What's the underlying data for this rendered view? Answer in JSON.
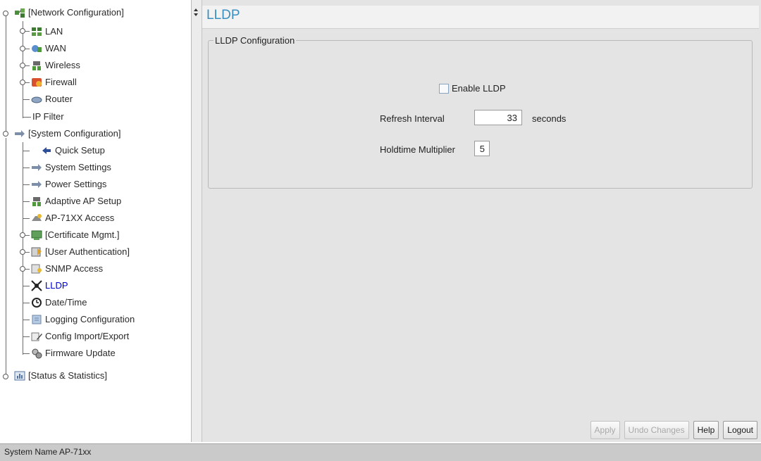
{
  "tree": {
    "nodes": [
      {
        "label": "[Network Configuration]",
        "icon": "network-config-icon"
      },
      {
        "label": "LAN",
        "icon": "lan-icon"
      },
      {
        "label": "WAN",
        "icon": "wan-icon"
      },
      {
        "label": "Wireless",
        "icon": "wireless-icon"
      },
      {
        "label": "Firewall",
        "icon": "firewall-icon"
      },
      {
        "label": "Router",
        "icon": "router-icon"
      },
      {
        "label": "IP Filter",
        "icon": ""
      },
      {
        "label": "[System Configuration]",
        "icon": "system-config-icon"
      },
      {
        "label": "Quick Setup",
        "icon": "quick-setup-icon"
      },
      {
        "label": "System Settings",
        "icon": "system-settings-icon"
      },
      {
        "label": "Power Settings",
        "icon": "power-settings-icon"
      },
      {
        "label": "Adaptive AP Setup",
        "icon": "adaptive-ap-icon"
      },
      {
        "label": "AP-71XX Access",
        "icon": "ap-access-icon"
      },
      {
        "label": "[Certificate Mgmt.]",
        "icon": "certificate-icon"
      },
      {
        "label": "[User Authentication]",
        "icon": "user-auth-icon"
      },
      {
        "label": "SNMP Access",
        "icon": "snmp-icon"
      },
      {
        "label": "LLDP",
        "icon": "lldp-icon"
      },
      {
        "label": "Date/Time",
        "icon": "clock-icon"
      },
      {
        "label": "Logging Configuration",
        "icon": "logging-icon"
      },
      {
        "label": "Config Import/Export",
        "icon": "config-import-icon"
      },
      {
        "label": "Firmware Update",
        "icon": "firmware-icon"
      },
      {
        "label": "[Status & Statistics]",
        "icon": "status-stats-icon"
      }
    ],
    "selected": "LLDP"
  },
  "main": {
    "title": "LLDP",
    "group_title": "LLDP Configuration",
    "enable_lldp": {
      "label": "Enable LLDP",
      "checked": false
    },
    "refresh_interval": {
      "label": "Refresh Interval",
      "value": "33",
      "unit": "seconds"
    },
    "holdtime_multiplier": {
      "label": "Holdtime Multiplier",
      "value": "5"
    }
  },
  "buttons": {
    "apply": "Apply",
    "undo": "Undo Changes",
    "help": "Help",
    "logout": "Logout"
  },
  "statusbar": {
    "text": "System Name AP-71xx"
  },
  "colors": {
    "title_blue": "#3a8ec0",
    "panel_bg": "#e4e4e4"
  }
}
